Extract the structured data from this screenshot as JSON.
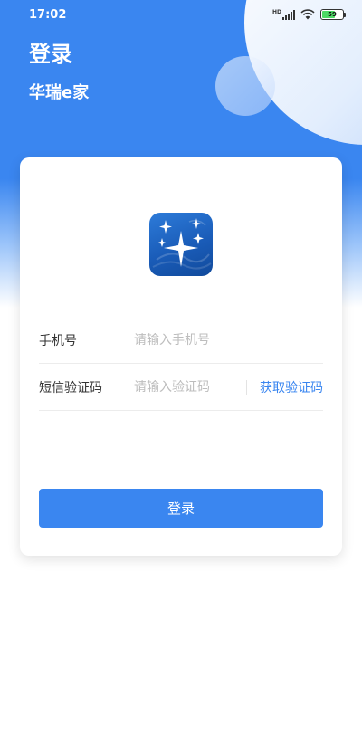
{
  "status_bar": {
    "time": "17:02",
    "network_label": "HD",
    "battery_level": "59",
    "icons": [
      "signal-icon",
      "wifi-icon",
      "battery-icon"
    ]
  },
  "header": {
    "title": "登录",
    "subtitle": "华瑞e家"
  },
  "form": {
    "phone": {
      "label": "手机号",
      "value": "",
      "placeholder": "请输入手机号"
    },
    "code": {
      "label": "短信验证码",
      "value": "",
      "placeholder": "请输入验证码",
      "get_code_label": "获取验证码"
    },
    "submit_label": "登录"
  },
  "colors": {
    "primary": "#3a86f0",
    "label_text": "#333333",
    "placeholder": "#bdbdbd",
    "divider": "#ececec"
  }
}
